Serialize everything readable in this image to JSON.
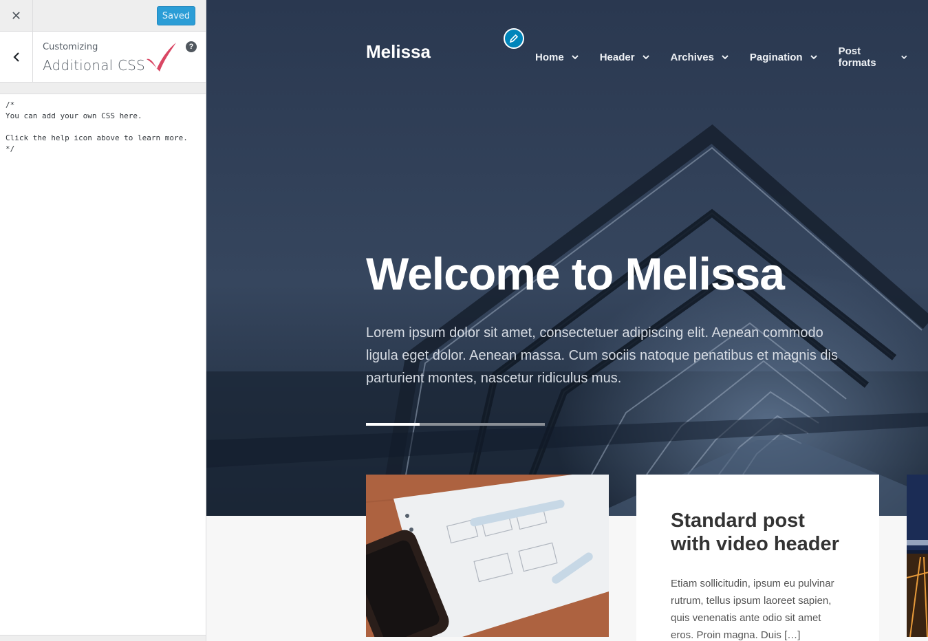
{
  "customizer": {
    "close_icon": "close-icon",
    "saved_label": "Saved",
    "customizing_label": "Customizing",
    "section_title": "Additional CSS",
    "help_icon_label": "?",
    "css_content": "/*\nYou can add your own CSS here.\n\nClick the help icon above to learn more.\n*/",
    "accent_color": "#2b9dd6",
    "checkmark_color": "#d94663"
  },
  "site": {
    "title": "Melissa",
    "nav": [
      {
        "label": "Home"
      },
      {
        "label": "Header"
      },
      {
        "label": "Archives"
      },
      {
        "label": "Pagination"
      },
      {
        "label": "Post formats"
      }
    ]
  },
  "hero": {
    "title": "Welcome to Melissa",
    "text": "Lorem ipsum dolor sit amet, consectetuer adipiscing elit. Aenean commodo ligula eget dolor. Aenean massa. Cum sociis natoque penatibus et magnis dis parturient montes, nascetur ridiculus mus.",
    "slider_progress": 0.3
  },
  "posts": [
    {
      "title": "Standard post with video header",
      "excerpt": "Etiam sollicitudin, ipsum eu pulvinar rutrum, tellus ipsum laoreet sapien, quis venenatis ante odio sit amet eros. Proin magna. Duis […]"
    }
  ]
}
